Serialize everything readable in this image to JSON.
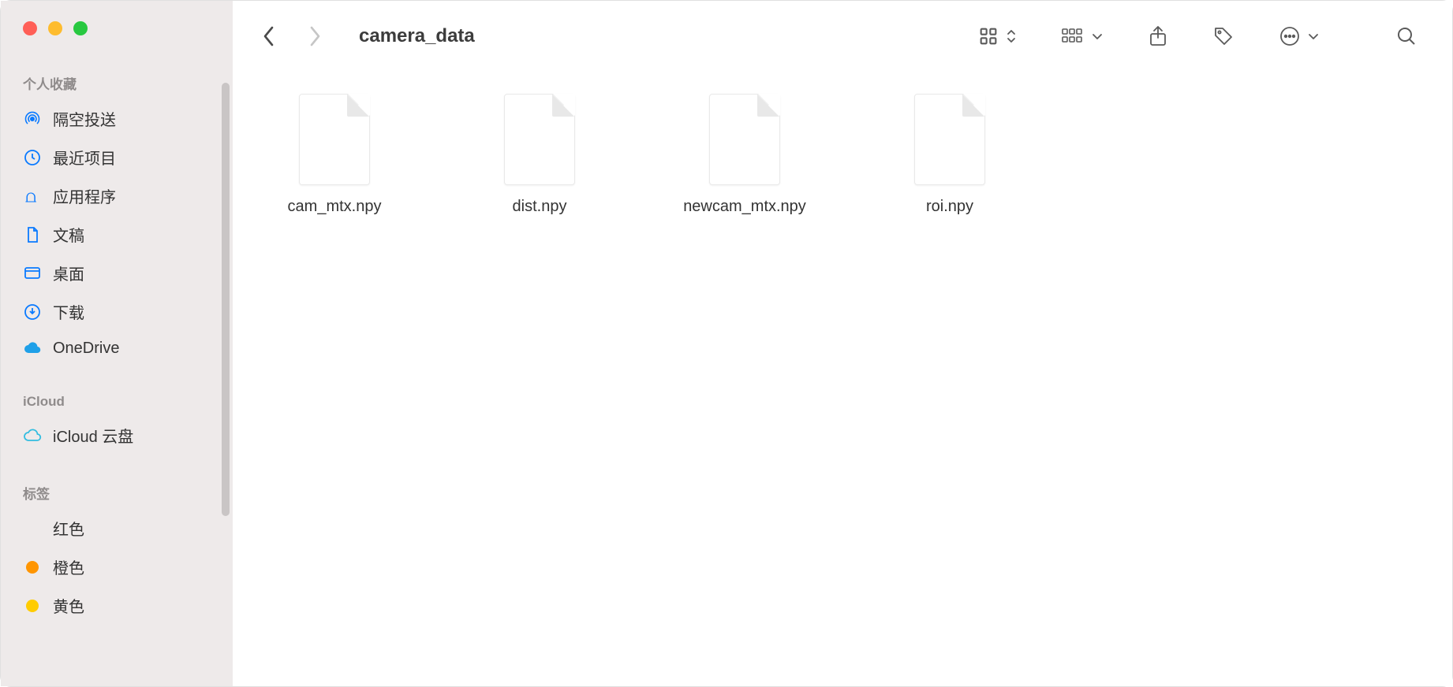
{
  "window": {
    "title": "camera_data"
  },
  "sidebar": {
    "sections": [
      {
        "header": "个人收藏",
        "items": [
          {
            "icon": "airdrop",
            "label": "隔空投送"
          },
          {
            "icon": "clock",
            "label": "最近项目"
          },
          {
            "icon": "apps",
            "label": "应用程序"
          },
          {
            "icon": "document",
            "label": "文稿"
          },
          {
            "icon": "desktop",
            "label": "桌面"
          },
          {
            "icon": "download",
            "label": "下载"
          },
          {
            "icon": "cloud-onedrive",
            "label": "OneDrive"
          }
        ]
      },
      {
        "header": "iCloud",
        "items": [
          {
            "icon": "cloud",
            "label": "iCloud 云盘"
          }
        ]
      },
      {
        "header": "标签",
        "items": [
          {
            "icon": "dot",
            "color": "#ff3b30",
            "label": "红色"
          },
          {
            "icon": "dot",
            "color": "#ff9500",
            "label": "橙色"
          },
          {
            "icon": "dot",
            "color": "#ffcc00",
            "label": "黄色"
          }
        ]
      }
    ]
  },
  "files": [
    {
      "name": "cam_mtx.npy"
    },
    {
      "name": "dist.npy"
    },
    {
      "name": "newcam_mtx.npy"
    },
    {
      "name": "roi.npy"
    }
  ],
  "colors": {
    "accent": "#0a7aff"
  }
}
